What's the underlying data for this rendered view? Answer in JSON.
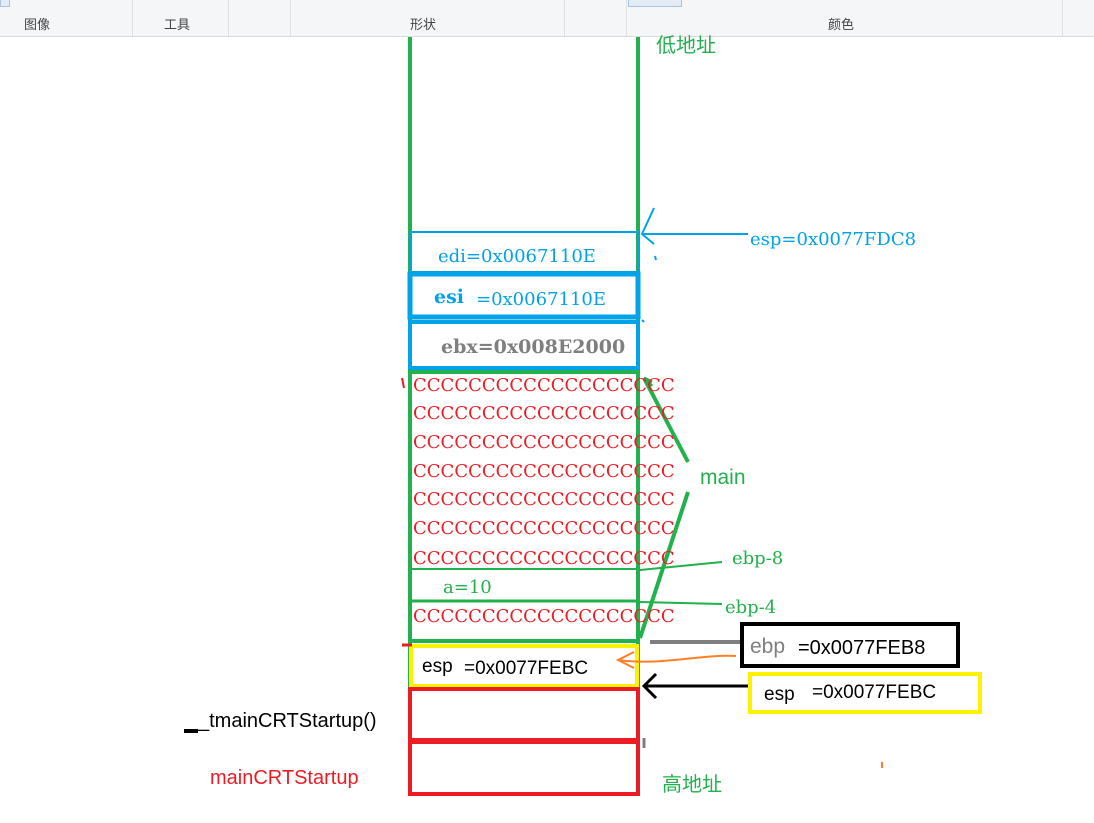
{
  "ribbon": {
    "groups": [
      "图像",
      "工具",
      "形状",
      "颜色"
    ]
  },
  "colors": {
    "green": "#22b14c",
    "blue": "#00a2e8",
    "red": "#ed1c24",
    "yellow": "#fff200",
    "black": "#000000",
    "orange": "#ff7f27",
    "gray": "#7f7f7f"
  },
  "labels": {
    "low_address": "低地址",
    "high_address": "高地址",
    "main": "main",
    "tmain": "_tmainCRTStartup()",
    "maincrt": "mainCRTStartup",
    "esp_top": "esp=0x0077FDC8",
    "ebp_minus8": "ebp-8",
    "ebp_minus4": "ebp-4",
    "ebp_box": "=0x0077FEB8",
    "ebp_box_prefix": "ebp",
    "esp_box": "=0x0077FEBC",
    "esp_box_prefix": "esp"
  },
  "stack": {
    "edi": "edi=0x0067110E",
    "esi_prefix": "esi",
    "esi_value": "=0x0067110E",
    "ebx": "ebx=0x008E2000",
    "fill_rows": [
      "CCCCCCCCCCCCCCCCCCC",
      "CCCCCCCCCCCCCCCCCCC",
      "CCCCCCCCCCCCCCCCCCC",
      "CCCCCCCCCCCCCCCCCCC",
      "CCCCCCCCCCCCCCCCCCC",
      "CCCCCCCCCCCCCCCCCCC",
      "CCCCCCCCCCCCCCCCCCC"
    ],
    "var_a": "a=10",
    "fill_row_last": "CCCCCCCCCCCCCCCCCCC",
    "saved_prefix": "esp",
    "saved_value": "=0x0077FEBC"
  }
}
